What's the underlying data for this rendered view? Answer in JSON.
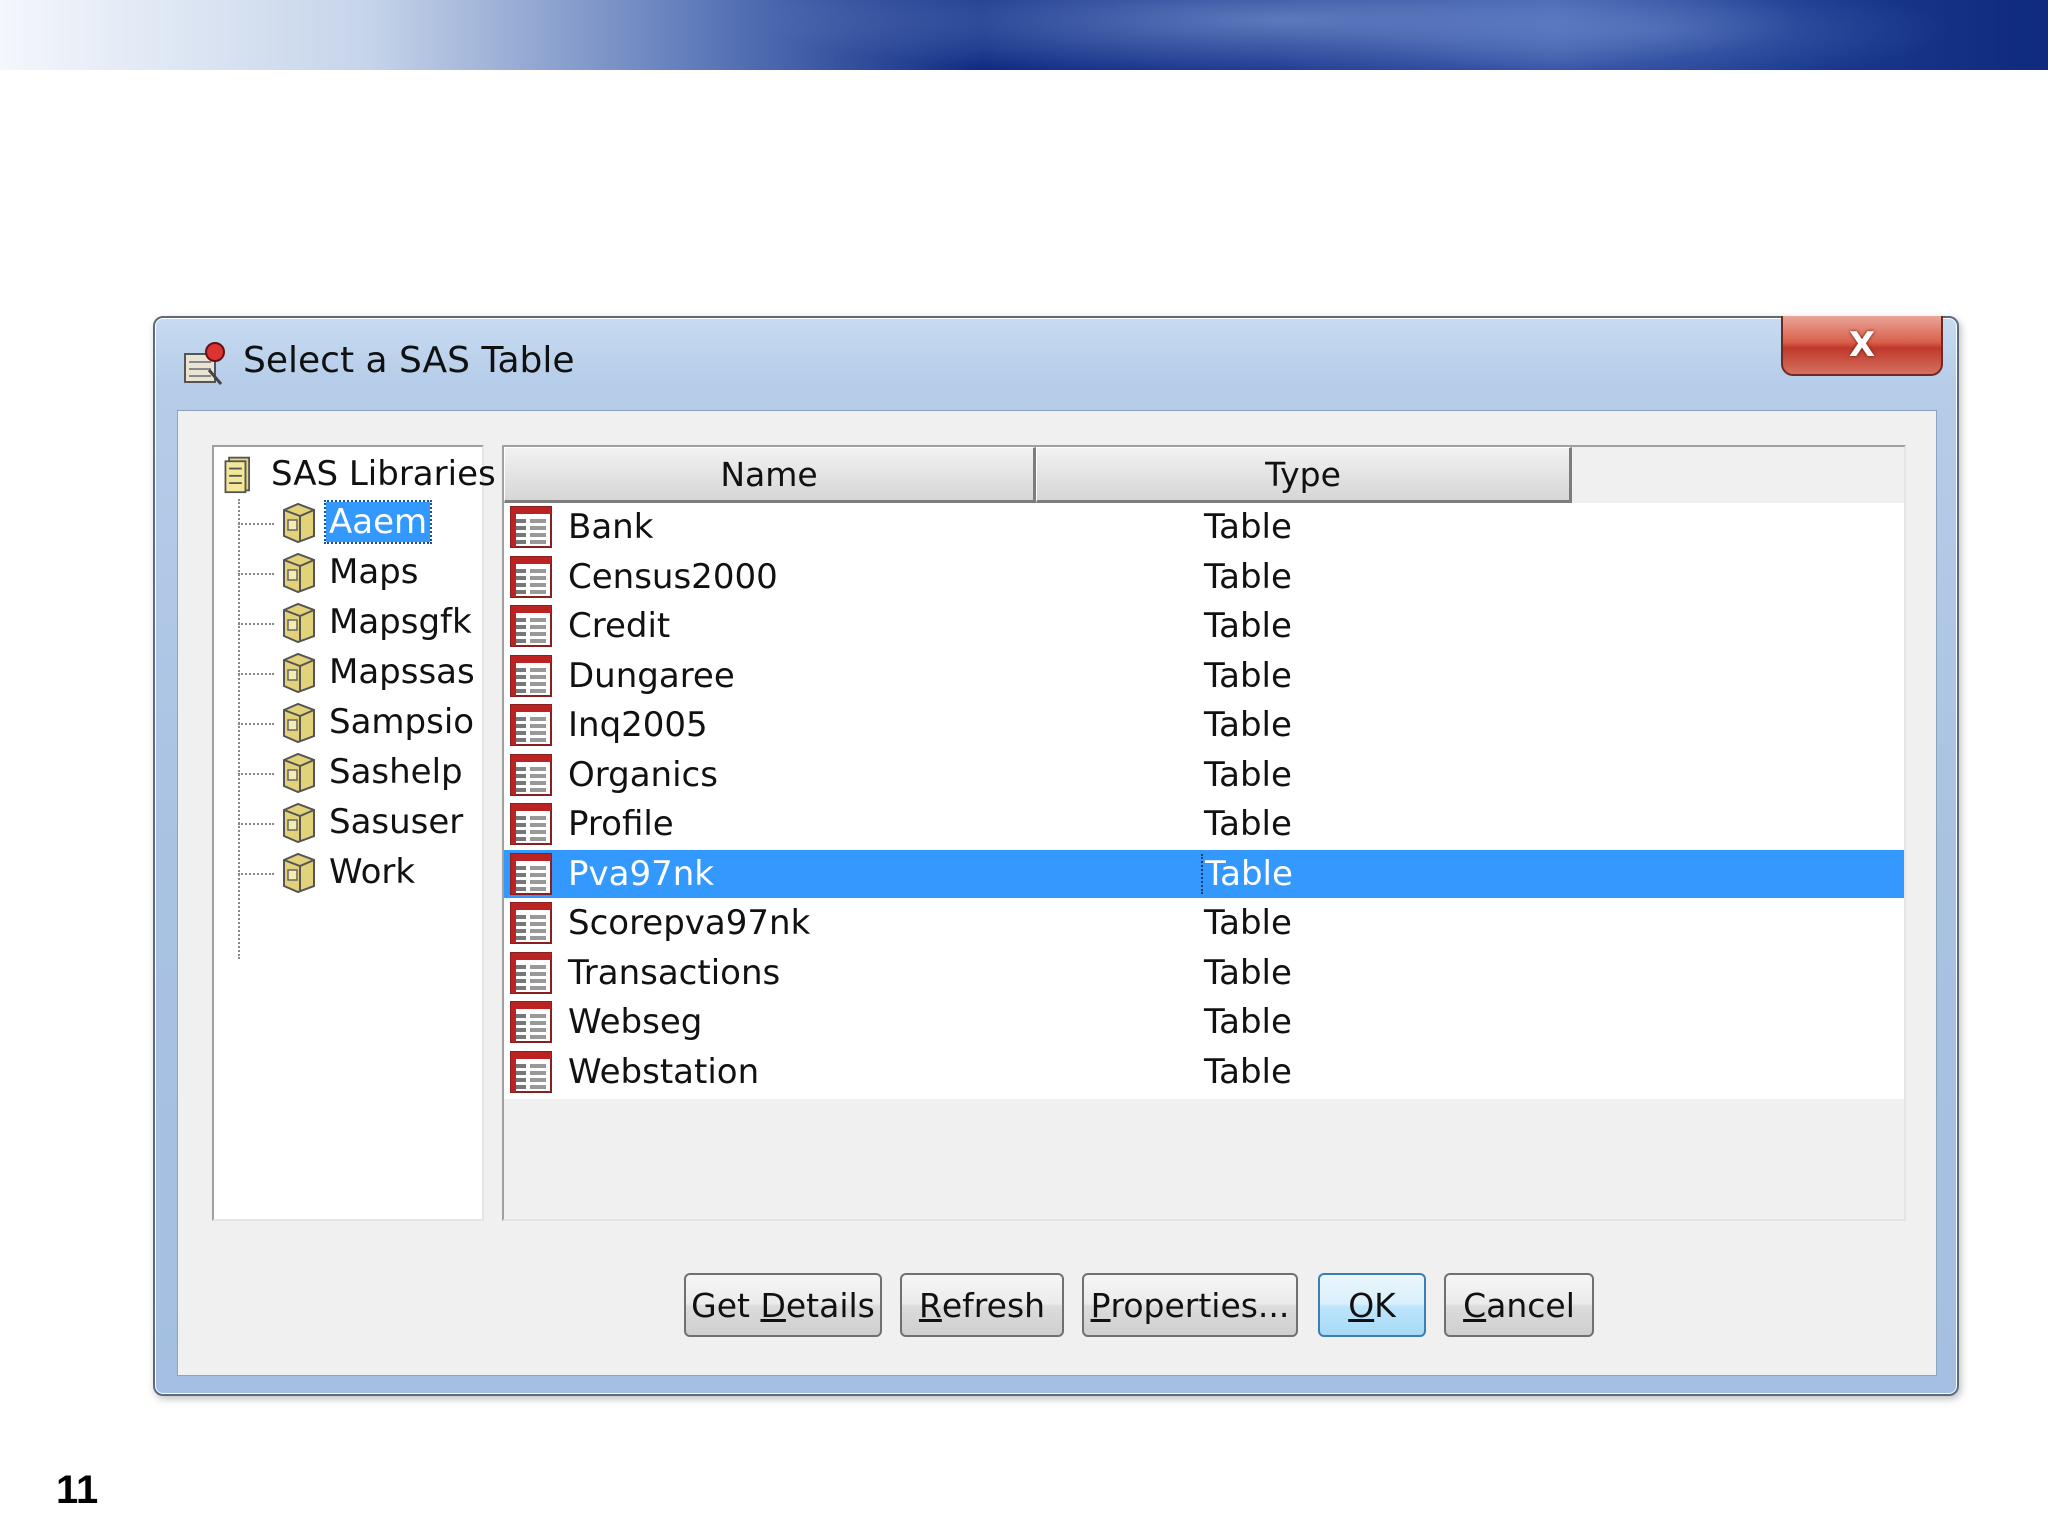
{
  "window": {
    "title": "Select a SAS Table",
    "close_glyph": "X"
  },
  "tree": {
    "root_label": "SAS Libraries",
    "root_icon": "library-icon",
    "libraries": [
      "Aaem",
      "Maps",
      "Mapsgfk",
      "Mapssas",
      "Sampsio",
      "Sashelp",
      "Sasuser",
      "Work"
    ],
    "selected": "Aaem",
    "library_icon": "folder-library-icon"
  },
  "list": {
    "columns": [
      "Name",
      "Type"
    ],
    "rows": [
      {
        "name": "Bank",
        "type": "Table"
      },
      {
        "name": "Census2000",
        "type": "Table"
      },
      {
        "name": "Credit",
        "type": "Table"
      },
      {
        "name": "Dungaree",
        "type": "Table"
      },
      {
        "name": "Inq2005",
        "type": "Table"
      },
      {
        "name": "Organics",
        "type": "Table"
      },
      {
        "name": "Profile",
        "type": "Table"
      },
      {
        "name": "Pva97nk",
        "type": "Table"
      },
      {
        "name": "Scorepva97nk",
        "type": "Table"
      },
      {
        "name": "Transactions",
        "type": "Table"
      },
      {
        "name": "Webseg",
        "type": "Table"
      },
      {
        "name": "Webstation",
        "type": "Table"
      }
    ],
    "selected_row": "Pva97nk",
    "row_icon": "sas-table-icon"
  },
  "buttons": {
    "get_details": {
      "pre": "Get ",
      "mnemonic": "D",
      "post": "etails"
    },
    "refresh": {
      "pre": "",
      "mnemonic": "R",
      "post": "efresh"
    },
    "properties": {
      "pre": "",
      "mnemonic": "P",
      "post": "roperties..."
    },
    "ok": {
      "pre": "",
      "mnemonic": "O",
      "post": "K"
    },
    "cancel": {
      "pre": "",
      "mnemonic": "C",
      "post": "ancel"
    }
  },
  "slide": {
    "number": "11"
  },
  "colors": {
    "selection": "#3399ff",
    "close_button": "#c0392b",
    "title_bar": "#b6cde9"
  }
}
